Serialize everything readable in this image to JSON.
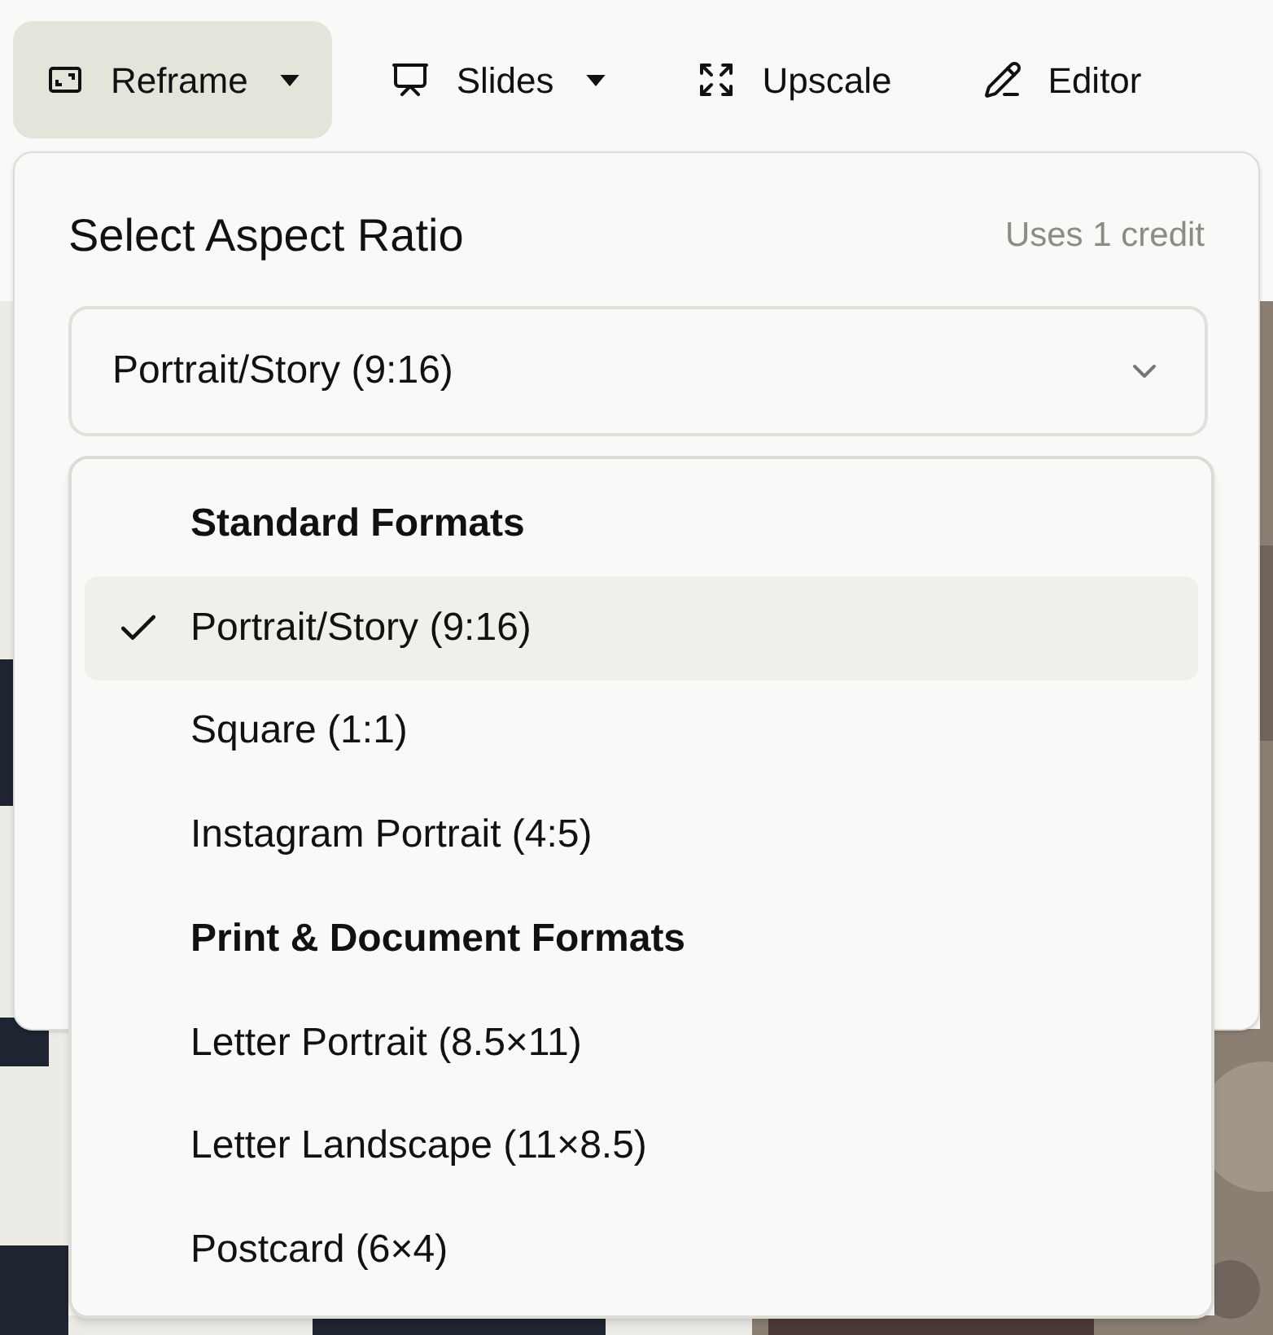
{
  "toolbar": [
    {
      "label": "Reframe",
      "has_menu": true,
      "selected": true
    },
    {
      "label": "Slides",
      "has_menu": true,
      "selected": false
    },
    {
      "label": "Upscale",
      "has_menu": false,
      "selected": false
    },
    {
      "label": "Editor",
      "has_menu": false,
      "selected": false
    }
  ],
  "panel": {
    "title": "Select Aspect Ratio",
    "credit_note": "Uses 1 credit",
    "select": {
      "value": "Portrait/Story (9:16)",
      "expanded": true
    },
    "options": [
      {
        "kind": "heading",
        "label": "Standard Formats"
      },
      {
        "kind": "option",
        "label": "Portrait/Story (9:16)",
        "selected": true
      },
      {
        "kind": "option",
        "label": "Square (1:1)",
        "selected": false
      },
      {
        "kind": "option",
        "label": "Instagram Portrait (4:5)",
        "selected": false
      },
      {
        "kind": "heading",
        "label": "Print & Document Formats"
      },
      {
        "kind": "option",
        "label": "Letter Portrait (8.5×11)",
        "selected": false
      },
      {
        "kind": "option",
        "label": "Letter Landscape (11×8.5)",
        "selected": false
      },
      {
        "kind": "option",
        "label": "Postcard (6×4)",
        "selected": false
      }
    ]
  }
}
